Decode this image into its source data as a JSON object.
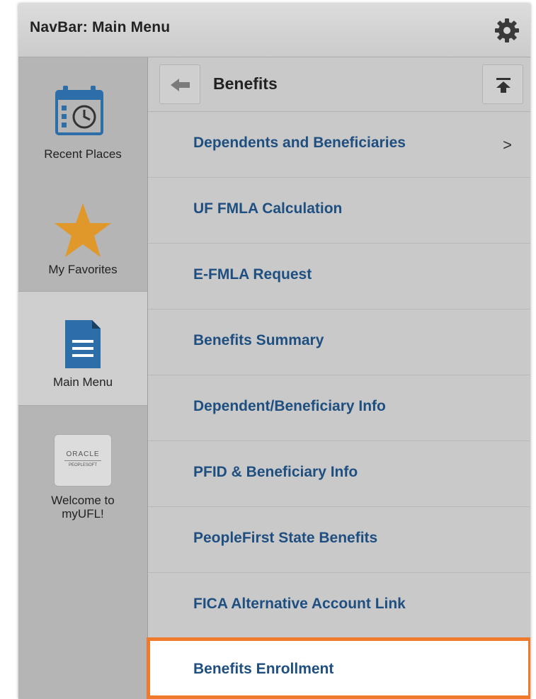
{
  "header": {
    "title": "NavBar: Main Menu",
    "settings_icon": "gear-icon"
  },
  "sidebar": {
    "items": [
      {
        "label": "Recent Places",
        "icon": "calendar-clock-icon"
      },
      {
        "label": "My Favorites",
        "icon": "star-icon",
        "icon_color": "#e0982a"
      },
      {
        "label": "Main Menu",
        "icon": "document-icon",
        "icon_color": "#2d6ea8",
        "selected": true
      },
      {
        "label": "Welcome to myUFL!",
        "icon": "oracle-peoplesoft-logo",
        "logo_line1": "ORACLE",
        "logo_line2": "PEOPLESOFT"
      }
    ]
  },
  "main": {
    "title": "Benefits",
    "back_icon": "back-arrow-icon",
    "top_icon": "scroll-to-top-icon",
    "items": [
      {
        "label": "Dependents and Beneficiaries",
        "chevron": ">"
      },
      {
        "label": "UF FMLA Calculation"
      },
      {
        "label": "E-FMLA Request"
      },
      {
        "label": "Benefits Summary"
      },
      {
        "label": "Dependent/Beneficiary Info"
      },
      {
        "label": "PFID & Beneficiary Info"
      },
      {
        "label": "PeopleFirst State Benefits"
      },
      {
        "label": "FICA Alternative Account Link"
      },
      {
        "label": "Benefits Enrollment",
        "highlighted": true
      }
    ]
  },
  "colors": {
    "link": "#1f4f80",
    "highlight_border": "#f07a2c",
    "favorites_star": "#e0982a",
    "document_icon": "#2d6ea8"
  }
}
